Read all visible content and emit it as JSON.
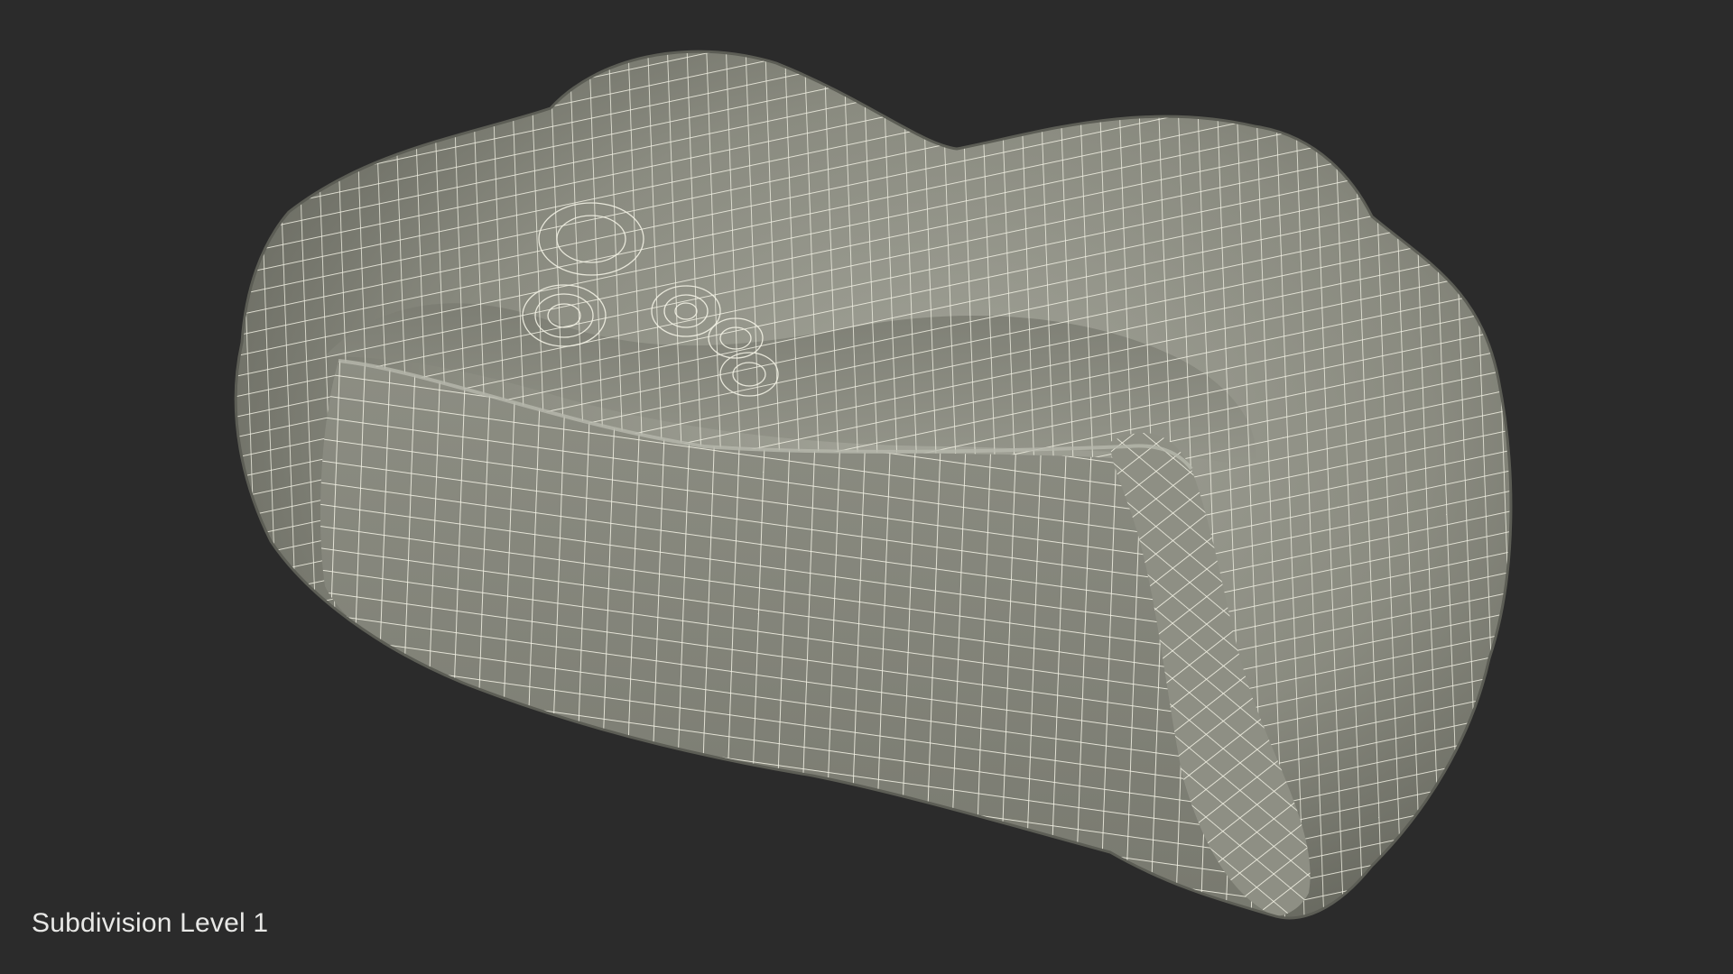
{
  "caption": {
    "text": "Subdivision Level 1"
  },
  "scene": {
    "background_color": "#2b2b2b",
    "surface_color": "#8a8b80",
    "surface_shadow_color": "#5e5f57",
    "surface_highlight_color": "#a9aa9f",
    "wire_color": "#f2f1e4",
    "object": "wireframe-sofa-mesh"
  }
}
